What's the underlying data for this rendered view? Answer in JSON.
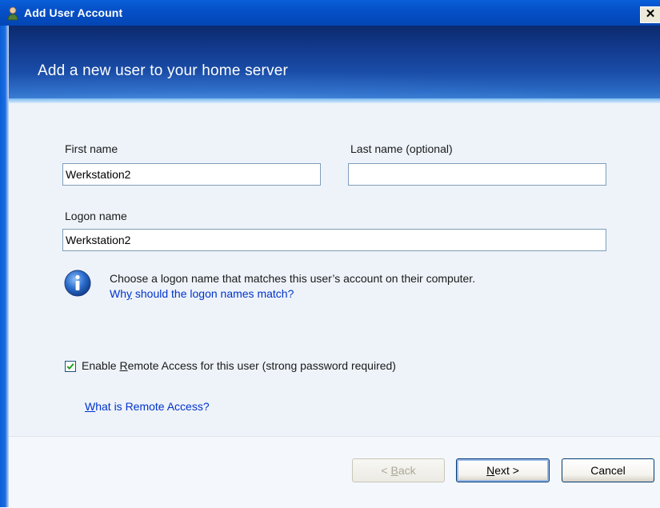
{
  "window": {
    "title": "Add User Account",
    "close_glyph": "✕",
    "icon": "user-account-icon",
    "colors": {
      "titlebar": "#0550c8",
      "banner": "#123a8e",
      "content_bg": "#eef3fa",
      "link": "#0033cc"
    }
  },
  "banner": {
    "heading": "Add a new user to your home server"
  },
  "form": {
    "first_name": {
      "label": "First name",
      "value": "Werkstation2",
      "placeholder": ""
    },
    "last_name": {
      "label": "Last name (optional)",
      "value": "",
      "placeholder": ""
    },
    "logon_name": {
      "label": "Logon name",
      "value": "Werkstation2",
      "placeholder": ""
    }
  },
  "info": {
    "icon": "info-icon",
    "text": "Choose a logon name that matches this user’s account on their computer.",
    "link_pre": "Wh",
    "link_acc": "y",
    "link_post": " should the logon names match?"
  },
  "remote_access": {
    "checked": true,
    "label_pre": "Enable ",
    "label_acc": "R",
    "label_post": "emote Access for this user (strong password required)",
    "help_link_acc": "W",
    "help_link_post": "hat is Remote Access?"
  },
  "buttons": {
    "back": {
      "pre": "< ",
      "acc": "B",
      "post": "ack",
      "enabled": false
    },
    "next": {
      "pre": "",
      "acc": "N",
      "post": "ext >",
      "enabled": true
    },
    "cancel": {
      "label": "Cancel",
      "enabled": true
    }
  }
}
